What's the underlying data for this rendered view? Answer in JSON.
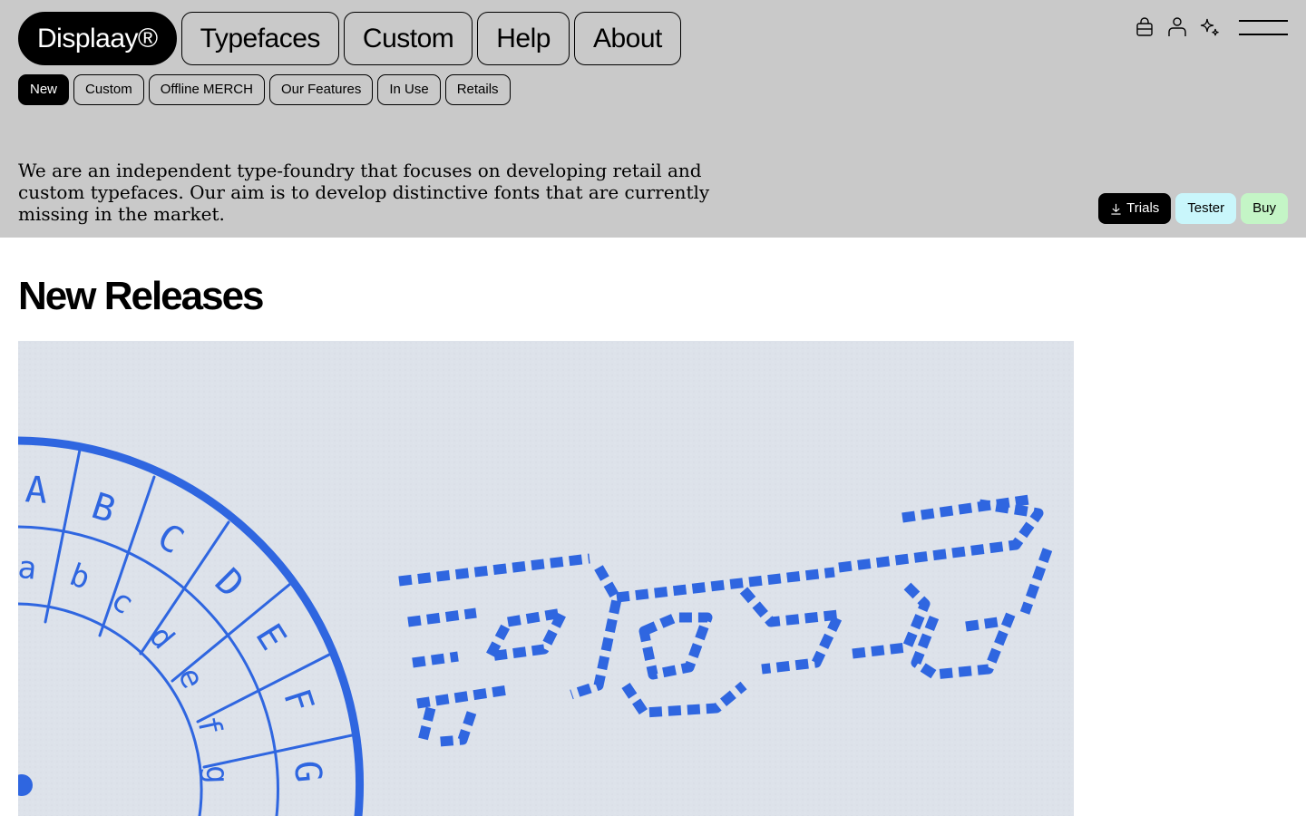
{
  "nav": {
    "brand": "Displaay®",
    "items": [
      "Typefaces",
      "Custom",
      "Help",
      "About"
    ]
  },
  "subnav": {
    "items": [
      "New",
      "Custom",
      "Offline MERCH",
      "Our Features",
      "In Use",
      "Retails"
    ],
    "active": "New"
  },
  "icons": [
    "bag-icon",
    "user-icon",
    "sparkle-icon",
    "menu-icon"
  ],
  "intro": "We are an independent type-foundry that focuses on developing retail and custom typefaces. Our aim is to develop distinctive fonts that are currently missing in the market.",
  "actions": {
    "trials": "Trials",
    "tester": "Tester",
    "buy": "Buy"
  },
  "section": {
    "title": "New Releases"
  },
  "hero": {
    "stamp_word": "Post",
    "wheel_upper": [
      "A",
      "B",
      "C",
      "D",
      "E",
      "F",
      "G"
    ],
    "wheel_lower": [
      "a",
      "b",
      "c",
      "d",
      "e",
      "f",
      "g"
    ],
    "ink_color": "#2f66e0"
  },
  "colors": {
    "header_bg": "#c9c9c9",
    "tester_bg": "#c9f6fb",
    "buy_bg": "#c4f5c6"
  }
}
